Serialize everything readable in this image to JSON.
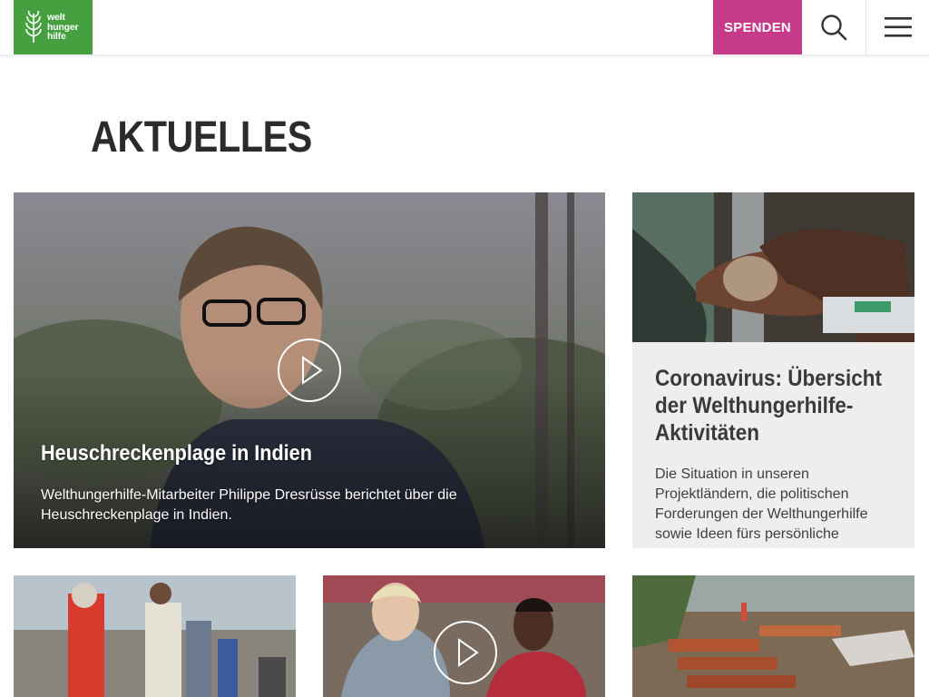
{
  "header": {
    "logo_text": [
      "welt",
      "hunger",
      "hilfe"
    ],
    "donate_label": "SPENDEN"
  },
  "page": {
    "title": "AKTUELLES"
  },
  "featured": {
    "title": "Heuschreckenplage in Indien",
    "text": "Welthungerhilfe-Mitarbeiter Philippe Dresrüsse berichtet über die Heuschreckenplage in Indien."
  },
  "side_card": {
    "title": "Coronavirus: Übersicht der Welthungerhilfe-Aktivitäten",
    "text": "Die Situation in unseren Projektländern, die politischen Forderungen der Welthungerhilfe sowie Ideen fürs persönliche"
  },
  "colors": {
    "brand_green": "#46a040",
    "donate_pink": "#c73a8a",
    "title_dark": "#2b2b2b"
  },
  "icons": [
    "welthungerhilfe-logo-icon",
    "search-icon",
    "menu-icon",
    "play-icon"
  ]
}
